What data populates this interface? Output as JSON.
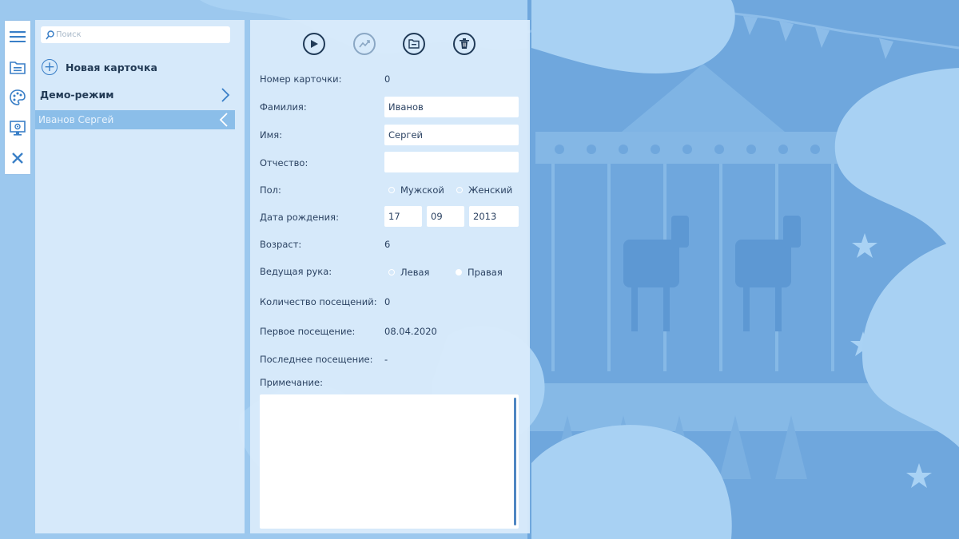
{
  "toolbar": {
    "icons": [
      "menu-icon",
      "folder-icon",
      "palette-icon",
      "monitor-settings-icon",
      "close-icon"
    ]
  },
  "sidebar": {
    "search_placeholder": "Поиск",
    "new_card_label": "Новая карточка",
    "demo_label": "Демо-режим",
    "selected_item": "Иванов Сергей"
  },
  "form": {
    "actions": [
      "play-icon",
      "chart-icon",
      "folder-icon",
      "trash-icon"
    ],
    "card_number": {
      "label": "Номер карточки:",
      "value": "0"
    },
    "last_name": {
      "label": "Фамилия:",
      "value": "Иванов"
    },
    "first_name": {
      "label": "Имя:",
      "value": "Сергей"
    },
    "patronymic": {
      "label": "Отчество:",
      "value": ""
    },
    "gender": {
      "label": "Пол:",
      "options": [
        "Мужской",
        "Женский"
      ]
    },
    "birth_date": {
      "label": "Дата рождения:",
      "day": "17",
      "month": "09",
      "year": "2013"
    },
    "age": {
      "label": "Возраст:",
      "value": "6"
    },
    "leading_hand": {
      "label": "Ведущая рука:",
      "options": [
        "Левая",
        "Правая"
      ],
      "selected": "Правая"
    },
    "visits": {
      "label": "Количество посещений:",
      "value": "0"
    },
    "first_visit": {
      "label": "Первое посещение:",
      "value": "08.04.2020"
    },
    "last_visit": {
      "label": "Последнее посещение:",
      "value": "-"
    },
    "note": {
      "label": "Примечание:",
      "value": ""
    }
  },
  "colors": {
    "background": "#9cc8ee",
    "panel": "#daecfb",
    "accent": "#3a7fc7",
    "selected": "#8bbee9"
  }
}
